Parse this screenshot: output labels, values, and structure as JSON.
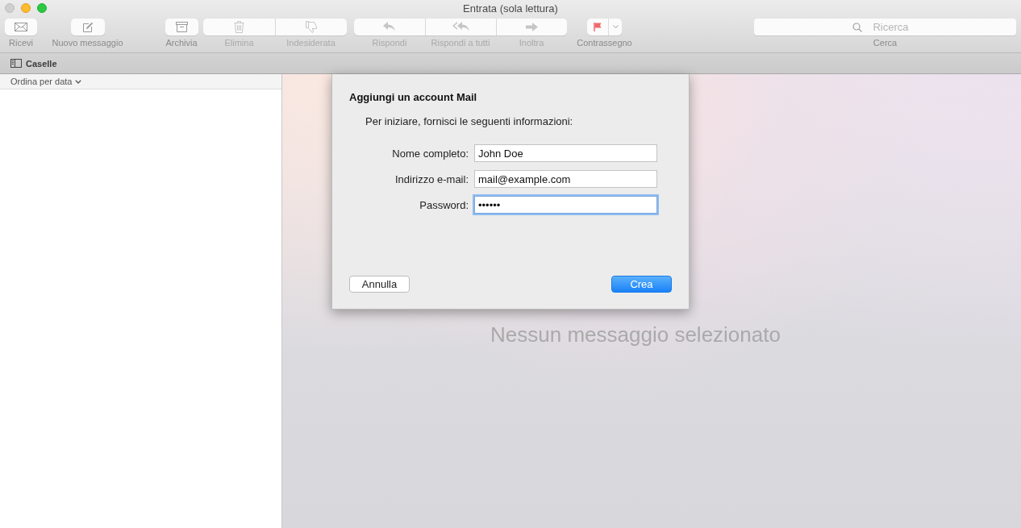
{
  "window": {
    "title": "Entrata (sola lettura)"
  },
  "toolbar": {
    "groups": [
      {
        "items": [
          {
            "kind": "get-mail",
            "label": "Ricevi",
            "disabled": false
          }
        ]
      },
      {
        "items": [
          {
            "kind": "compose",
            "label": "Nuovo messaggio",
            "disabled": false
          }
        ]
      },
      {
        "items": [
          {
            "kind": "archive",
            "label": "Archivia",
            "disabled": false
          }
        ]
      },
      {
        "items": [
          {
            "kind": "delete",
            "label": "Elimina",
            "disabled": true
          },
          {
            "kind": "junk",
            "label": "Indesiderata",
            "disabled": true
          }
        ]
      },
      {
        "items": [
          {
            "kind": "reply",
            "label": "Rispondi",
            "disabled": true
          },
          {
            "kind": "reply-all",
            "label": "Rispondi a tutti",
            "disabled": true
          },
          {
            "kind": "forward",
            "label": "Inoltra",
            "disabled": true
          }
        ]
      },
      {
        "items": [
          {
            "kind": "flag",
            "label": "Contrassegno",
            "disabled": false
          }
        ]
      }
    ],
    "search": {
      "placeholder": "Ricerca",
      "label": "Cerca"
    }
  },
  "mailboxes_bar": {
    "label": "Caselle"
  },
  "message_list": {
    "sort_label": "Ordina per data"
  },
  "viewer": {
    "empty_text": "Nessun messaggio selezionato"
  },
  "dialog": {
    "title": "Aggiungi un account Mail",
    "intro": "Per iniziare, fornisci le seguenti informazioni:",
    "fields": [
      {
        "label": "Nome completo:",
        "value": "John Doe",
        "focused": false
      },
      {
        "label": "Indirizzo e-mail:",
        "value": "mail@example.com",
        "focused": false
      },
      {
        "label": "Password:",
        "value": "••••••",
        "focused": true
      }
    ],
    "buttons": [
      {
        "label": "Annulla",
        "kind": "secondary"
      },
      {
        "label": "Crea",
        "kind": "primary"
      }
    ]
  }
}
